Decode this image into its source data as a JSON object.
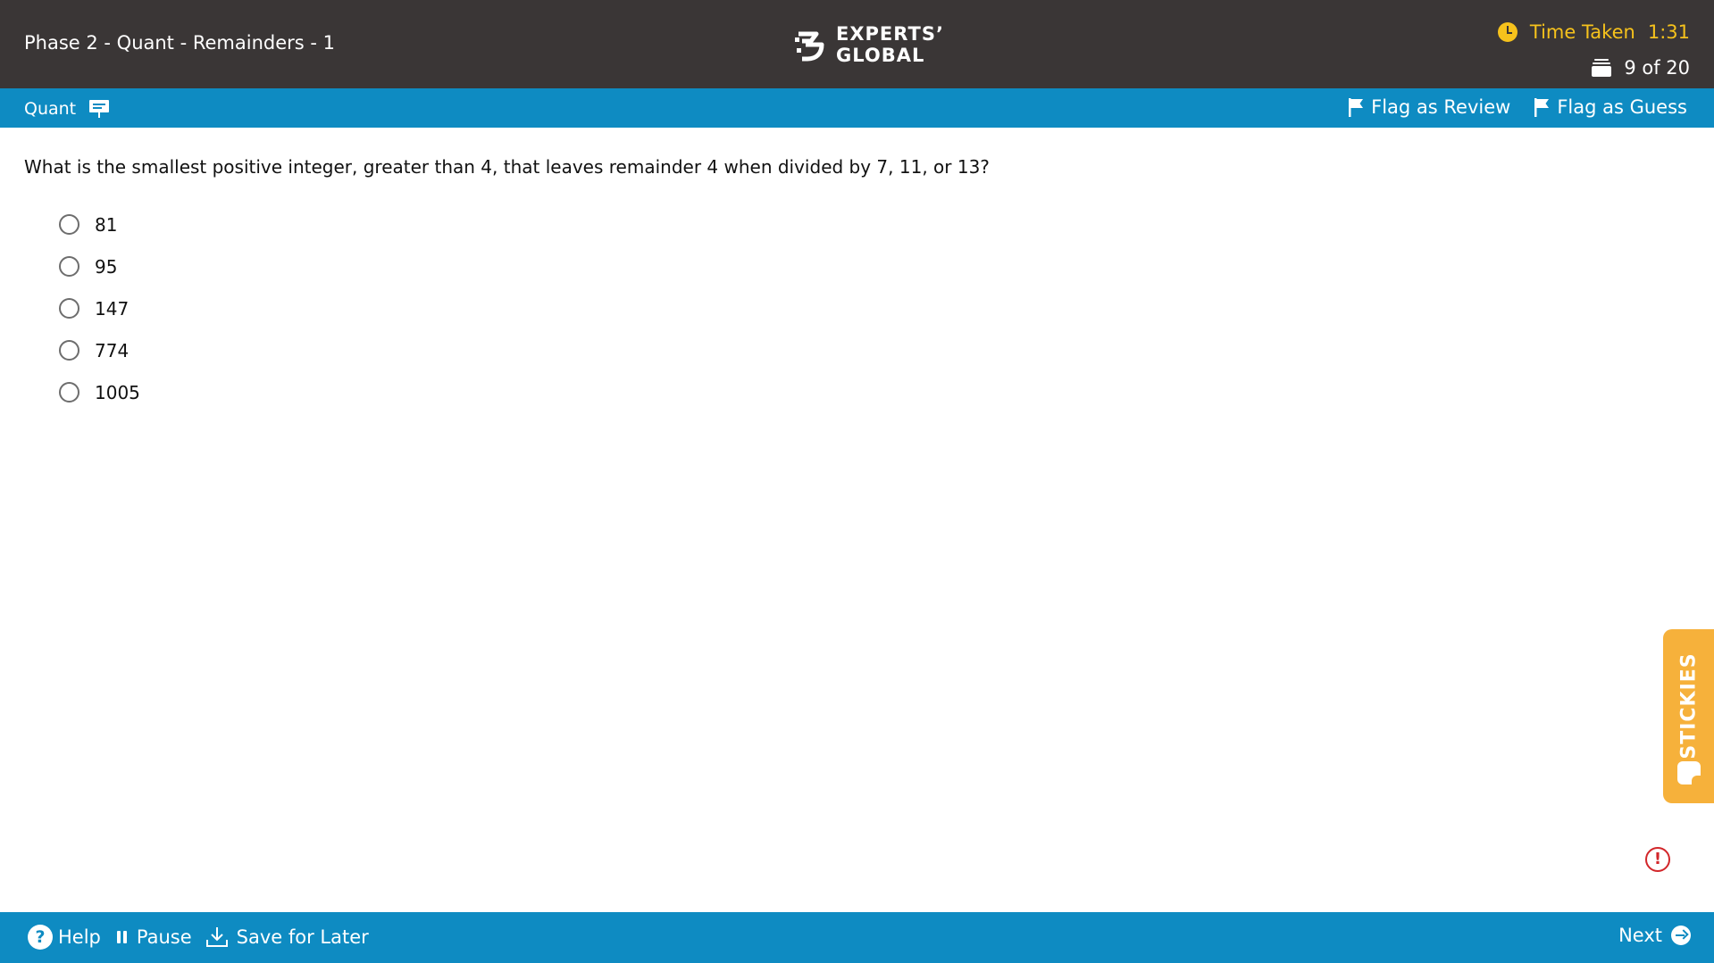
{
  "header": {
    "title": "Phase 2 - Quant - Remainders - 1",
    "logo_line1": "EXPERTS’",
    "logo_line2": "GLOBAL",
    "time_label": "Time Taken",
    "time_value": "1:31",
    "progress": "9 of 20",
    "accent_color": "#f6c21c"
  },
  "section_bar": {
    "section_name": "Quant",
    "flag_review_label": "Flag as Review",
    "flag_guess_label": "Flag as Guess",
    "bar_color": "#0e8bc2"
  },
  "question": {
    "text": "What is the smallest positive integer, greater than 4, that leaves remainder 4 when divided by 7, 11, or 13?",
    "options": [
      {
        "label": "81",
        "selected": false
      },
      {
        "label": "95",
        "selected": false
      },
      {
        "label": "147",
        "selected": false
      },
      {
        "label": "774",
        "selected": false
      },
      {
        "label": "1005",
        "selected": false
      }
    ]
  },
  "stickies": {
    "label": "STICKIES",
    "color": "#f6b13b"
  },
  "alert_icon": "!",
  "footer": {
    "help_label": "Help",
    "pause_label": "Pause",
    "save_label": "Save for Later",
    "next_label": "Next"
  }
}
